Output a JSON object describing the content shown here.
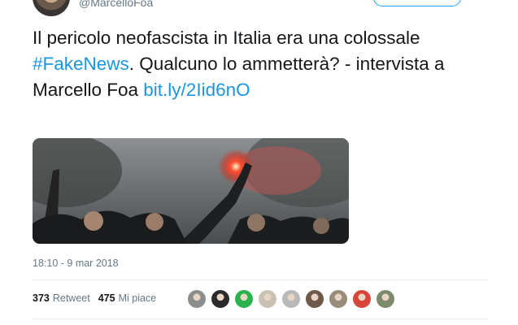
{
  "header": {
    "handle": "@MarcelloFoa"
  },
  "tweet": {
    "text_part1": "Il pericolo neofascista in Italia era una colossale ",
    "hashtag": "#FakeNews",
    "text_part2": ". Qualcuno lo ammetterà? - intervista a Marcello Foa ",
    "link": "bit.ly/2Iid6nO",
    "timestamp": "18:10 - 9 mar 2018"
  },
  "stats": {
    "retweets_count": "373",
    "retweets_label": "Retweet",
    "likes_count": "475",
    "likes_label": "Mi piace"
  },
  "likers": [
    {
      "name": "liker-avatar-1",
      "color": "#8a8f8c"
    },
    {
      "name": "liker-avatar-2",
      "color": "#2b2b2b"
    },
    {
      "name": "liker-avatar-3",
      "color": "#2bb24c"
    },
    {
      "name": "liker-avatar-4",
      "color": "#c9c2b4"
    },
    {
      "name": "liker-avatar-5",
      "color": "#b8b8b8"
    },
    {
      "name": "liker-avatar-6",
      "color": "#6d5a4a"
    },
    {
      "name": "liker-avatar-7",
      "color": "#9a8c7a"
    },
    {
      "name": "liker-avatar-8",
      "color": "#d8463a"
    },
    {
      "name": "liker-avatar-9",
      "color": "#7a8a6a"
    }
  ],
  "colors": {
    "link": "#1b95e0",
    "secondary_text": "#657786",
    "primary_text": "#14171a"
  }
}
